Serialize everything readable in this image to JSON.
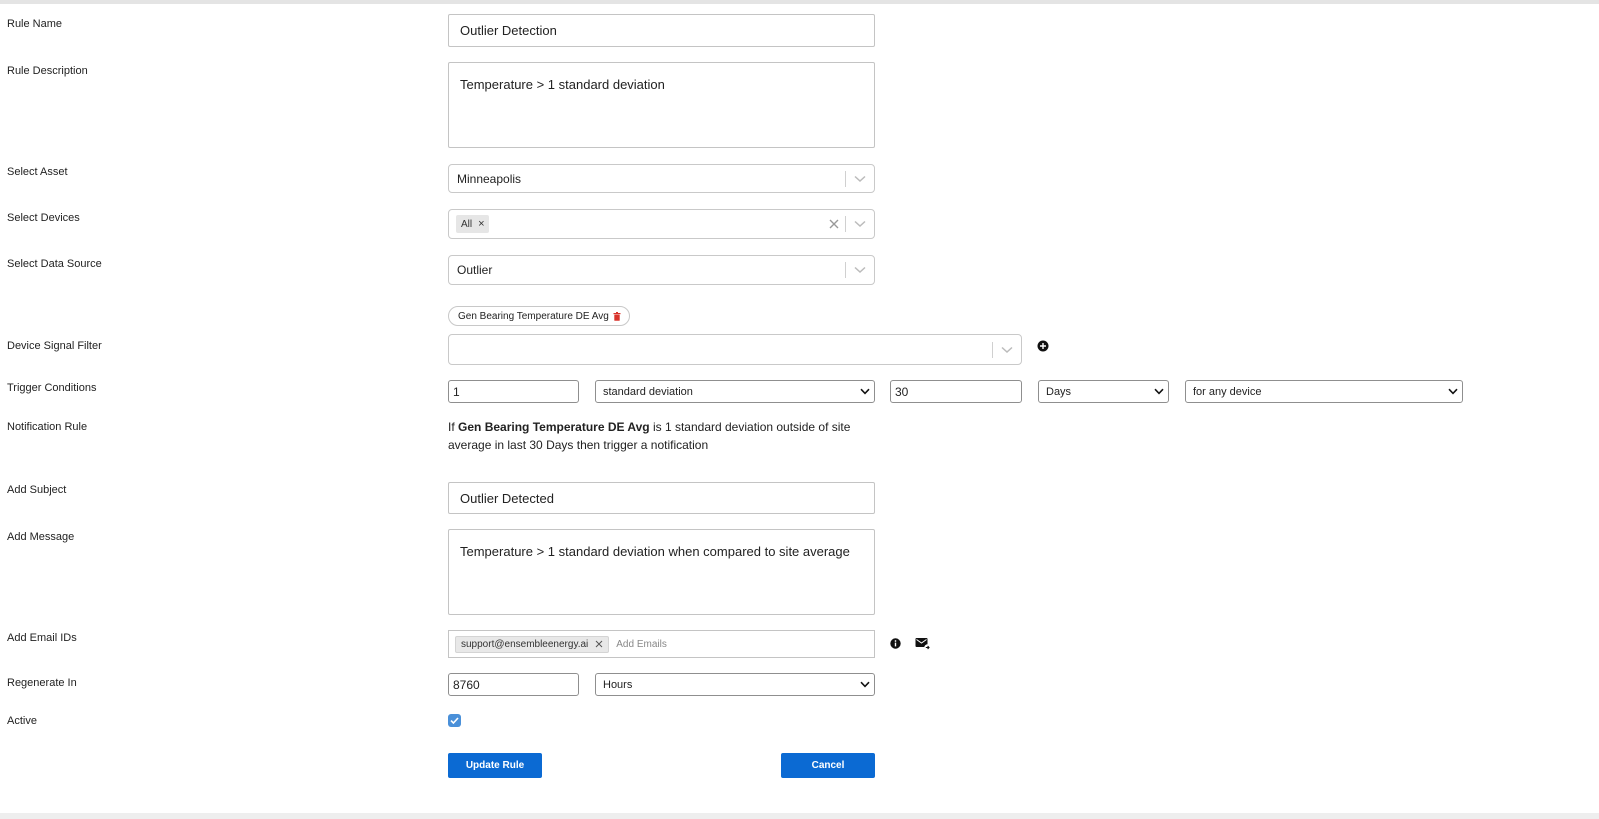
{
  "labels": {
    "rule_name": "Rule Name",
    "rule_description": "Rule Description",
    "select_asset": "Select Asset",
    "select_devices": "Select Devices",
    "select_data_source": "Select Data Source",
    "device_signal_filter": "Device Signal Filter",
    "trigger_conditions": "Trigger Conditions",
    "notification_rule": "Notification Rule",
    "add_subject": "Add Subject",
    "add_message": "Add Message",
    "add_email_ids": "Add Email IDs",
    "regenerate_in": "Regenerate In",
    "active": "Active"
  },
  "rule_name": "Outlier Detection",
  "rule_description": "Temperature > 1 standard deviation",
  "asset": "Minneapolis",
  "devices": {
    "chips": [
      "All"
    ]
  },
  "data_source": "Outlier",
  "signal_filter": {
    "selected_signal": "Gen Bearing Temperature DE Avg",
    "value": ""
  },
  "trigger": {
    "threshold": "1",
    "measure": "standard deviation",
    "period_value": "30",
    "period_unit": "Days",
    "scope": "for any device"
  },
  "notification_rule": {
    "prefix": "If ",
    "signal": "Gen Bearing Temperature DE Avg",
    "middle": " is 1 standard deviation outside of site average in last 30 Days then trigger a notification"
  },
  "subject": "Outlier Detected",
  "message": "Temperature > 1 standard deviation when compared to site average",
  "emails": {
    "chips": [
      "support@ensembleenergy.ai"
    ],
    "placeholder": "Add Emails"
  },
  "regenerate": {
    "value": "8760",
    "unit": "Hours"
  },
  "active": true,
  "buttons": {
    "update": "Update Rule",
    "cancel": "Cancel"
  },
  "colors": {
    "primary": "#0b6ad3",
    "checkbox": "#4a90d9",
    "delete_icon": "#d9342b"
  }
}
